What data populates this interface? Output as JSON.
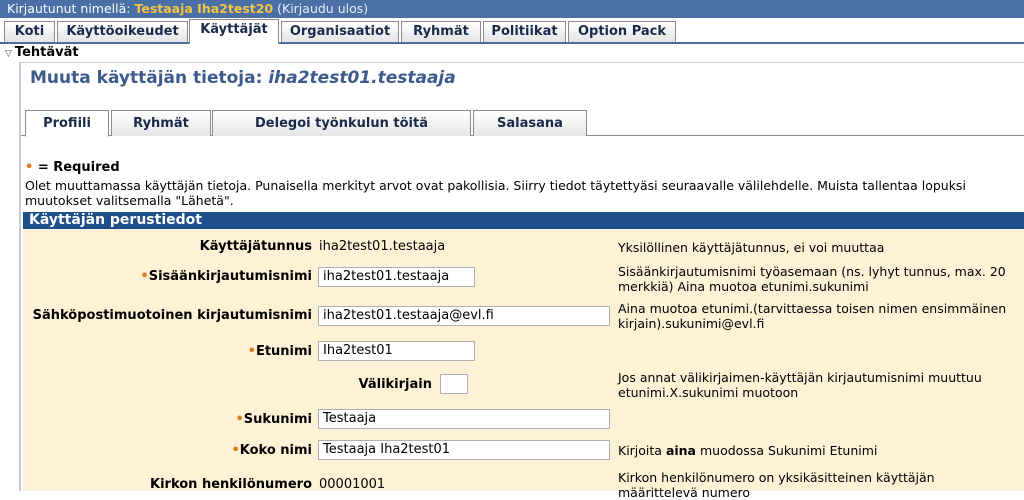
{
  "topbar": {
    "prefix": "Kirjautunut nimellä:",
    "user": "Testaaja Iha2test20",
    "logout": "(Kirjaudu ulos)"
  },
  "main_tabs": [
    "Koti",
    "Käyttöoikeudet",
    "Käyttäjät",
    "Organisaatiot",
    "Ryhmät",
    "Politiikat",
    "Option Pack"
  ],
  "tasks_label": "Tehtävät",
  "page_title": {
    "prefix": "Muuta käyttäjän tietoja: ",
    "user": "iha2test01.testaaja"
  },
  "sub_tabs": [
    "Profiili",
    "Ryhmät",
    "Delegoi työnkulun töitä",
    "Salasana"
  ],
  "required_legend": "= Required",
  "info_text": "Olet muuttamassa käyttäjän tietoja. Punaisella merkityt arvot ovat pakollisia. Siirry tiedot täytettyäsi seuraavalle välilehdelle. Muista tallentaa lopuksi muutokset valitsemalla \"Lähetä\".",
  "section_title": "Käyttäjän perustiedot",
  "fields": [
    {
      "label": "Käyttäjätunnus",
      "value": "iha2test01.testaaja",
      "help": "Yksilöllinen käyttäjätunnus, ei voi muuttaa"
    },
    {
      "label": "Sisäänkirjautumisnimi",
      "value": "iha2test01.testaaja",
      "help": "Sisäänkirjautumisnimi työasemaan (ns. lyhyt tunnus, max. 20 merkkiä) Aina muotoa etunimi.sukunimi"
    },
    {
      "label": "Sähköpostimuotoinen kirjautumisnimi",
      "value": "iha2test01.testaaja@evl.fi",
      "help": "Aina muotoa etunimi.(tarvittaessa toisen nimen ensimmäinen kirjain).sukunimi@evl.fi"
    },
    {
      "label": "Etunimi",
      "value": "Iha2test01",
      "help": ""
    },
    {
      "label": "Välikirjain",
      "value": "",
      "help": "Jos annat välikirjaimen-käyttäjän kirjautumisnimi muuttuu etunimi.X.sukunimi muotoon"
    },
    {
      "label": "Sukunimi",
      "value": "Testaaja",
      "help": ""
    },
    {
      "label": "Koko nimi",
      "value": "Testaaja Iha2test01",
      "help_pre": "Kirjoita ",
      "help_bold": "aina",
      "help_post": " muodossa Sukunimi Etunimi"
    },
    {
      "label": "Kirkon henkilönumero",
      "value": "00001001",
      "help": "Kirkon henkilönumero on yksikäsitteinen käyttäjän määrittelevä numero"
    }
  ],
  "colors": {
    "topbar": "#4a6fa5",
    "username": "#f6c542",
    "section_header": "#1f4e8c",
    "section_bg": "#fdf1d6",
    "title": "#3c5a8c",
    "required_dot": "#e07a1a"
  }
}
